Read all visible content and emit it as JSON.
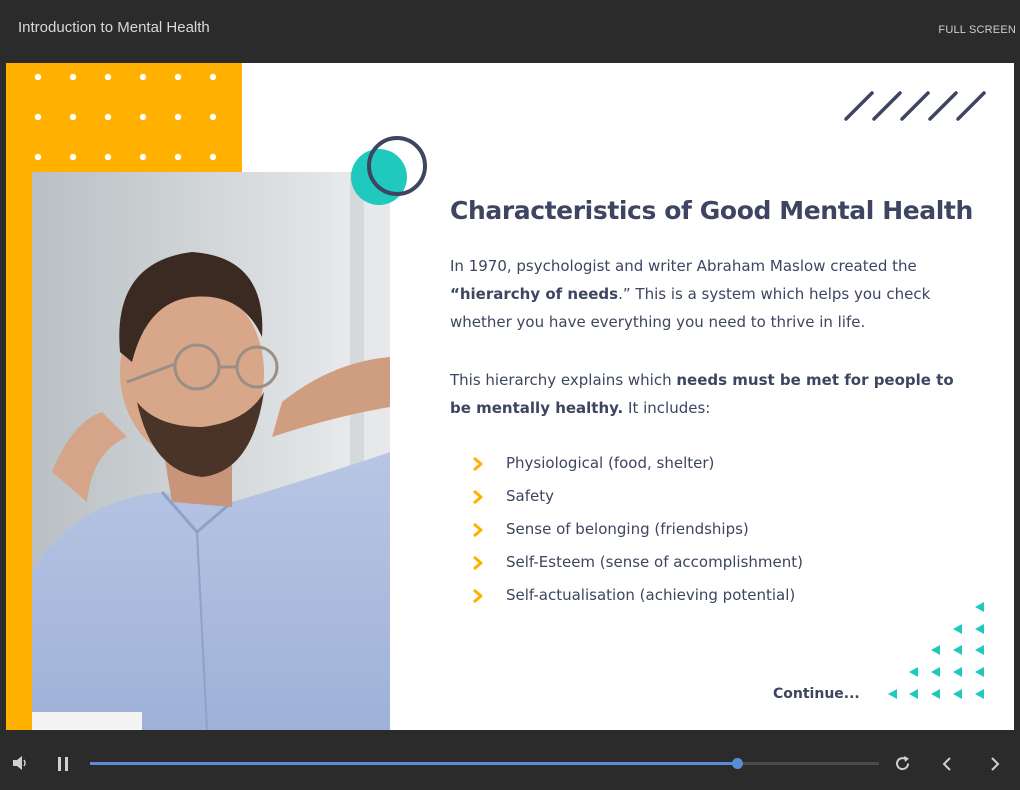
{
  "header": {
    "course_title": "Introduction to Mental Health",
    "fullscreen_label": "FULL SCREEN"
  },
  "slide": {
    "heading": "Characteristics of Good Mental Health",
    "para1": {
      "part1": "In 1970, psychologist and writer Abraham Maslow created the",
      "quote_open": "“",
      "bold": "hierarchy of needs",
      "quote_close": ".”",
      "part2": " This is a system which helps you check whether you have everything you need to thrive in life."
    },
    "para2": {
      "part1": "This hierarchy explains which ",
      "bold": "needs must be met for people to be mentally healthy.",
      "part2": " It includes:"
    },
    "bullets": [
      "Physiological (food, shelter)",
      "Safety",
      "Sense of belonging (friendships)",
      "Self-Esteem (sense of accomplishment)",
      "Self-actualisation (achieving potential)"
    ],
    "continue_label": "Continue..."
  },
  "player": {
    "progress_percent": 82
  },
  "colors": {
    "accent_yellow": "#ffb000",
    "teal": "#1fc9be",
    "navy": "#3d4560",
    "progress_blue": "#5b8dd4"
  },
  "icons": {
    "volume": "speaker-icon",
    "pause": "pause-icon",
    "replay": "replay-icon",
    "prev": "chevron-left-icon",
    "next": "chevron-right-icon",
    "bullet": "chevron-right-icon"
  }
}
